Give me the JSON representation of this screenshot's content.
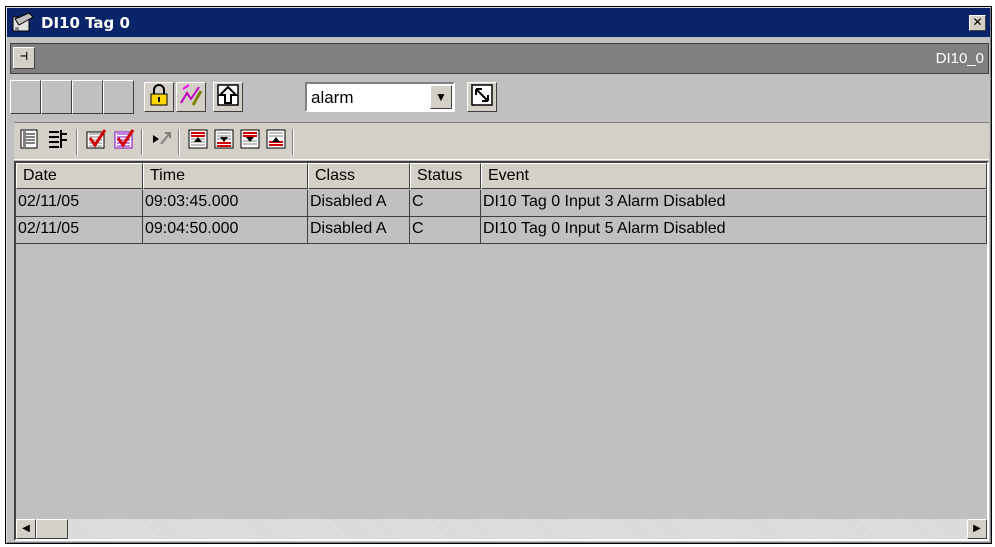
{
  "window": {
    "title": "DI10 Tag 0",
    "close_glyph": "✕"
  },
  "pinbar": {
    "pin_glyph": "⊣",
    "label": "DI10_0"
  },
  "toolbar": {
    "combo_value": "alarm",
    "combo_arrow": "▼",
    "icons": [
      "lock-icon",
      "signal-edit-icon",
      "up-arrow-icon",
      "resize-icon"
    ]
  },
  "toolbar2": {
    "icons": [
      "list-view-icon",
      "tree-view-icon",
      "acknowledge-icon",
      "acknowledge-all-icon",
      "play-to-icon",
      "move-top-icon",
      "move-down-icon",
      "move-bottom-icon",
      "move-up-icon"
    ]
  },
  "grid": {
    "columns": [
      "Date",
      "Time",
      "Class",
      "Status",
      "Event"
    ],
    "rows": [
      [
        "02/11/05",
        "09:03:45.000",
        "Disabled A",
        "C",
        "DI10 Tag 0 Input 3 Alarm Disabled"
      ],
      [
        "02/11/05",
        "09:04:50.000",
        "Disabled A",
        "C",
        "DI10 Tag 0 Input 5 Alarm Disabled"
      ]
    ]
  },
  "scrollbar": {
    "left_arrow": "◀",
    "right_arrow": "▶"
  },
  "colors": {
    "titlebar": "#0a246a",
    "face": "#c0c0c0",
    "pinbar": "#808080"
  }
}
